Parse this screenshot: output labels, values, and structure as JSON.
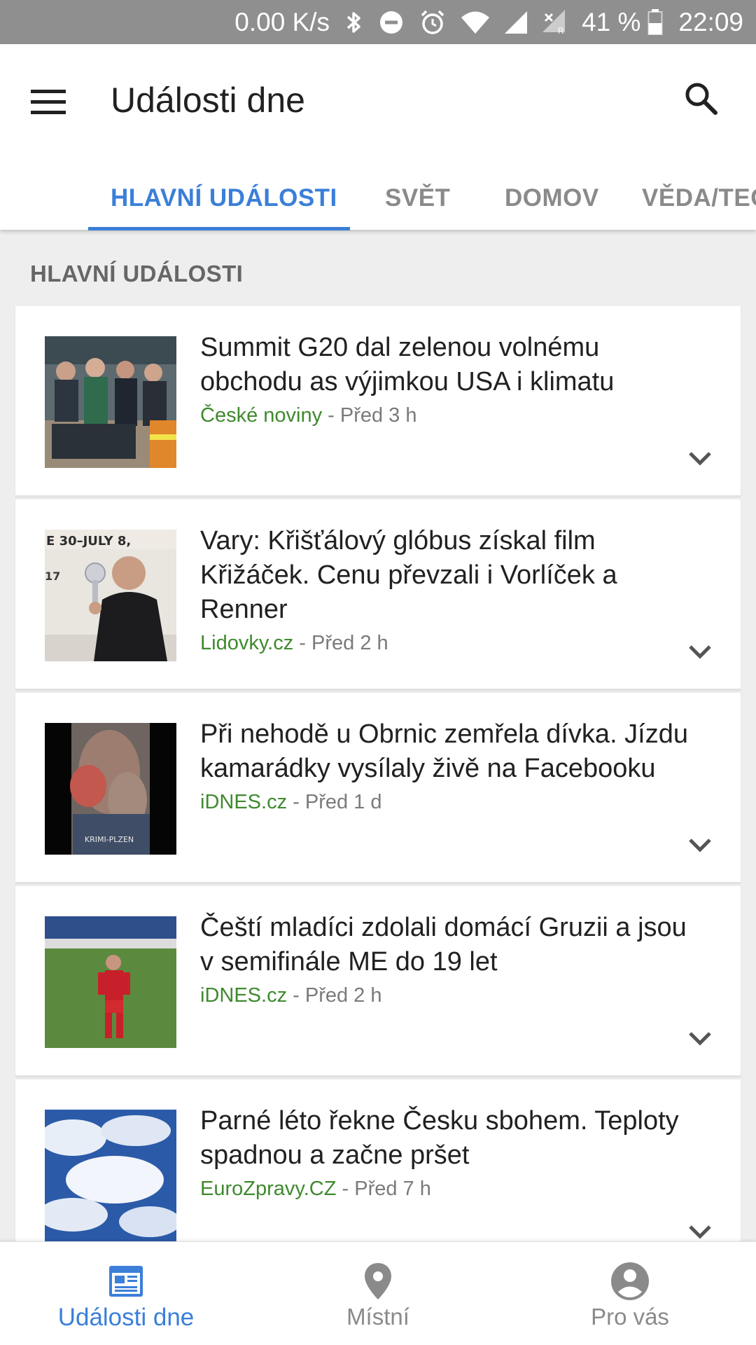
{
  "status_bar": {
    "net_speed": "0.00 K/s",
    "battery": "41 %",
    "time": "22:09",
    "icons": [
      "bluetooth-icon",
      "dnd-icon",
      "alarm-icon",
      "wifi-icon",
      "signal-icon",
      "signal-roaming-icon",
      "battery-icon"
    ]
  },
  "appbar": {
    "title": "Události dne",
    "menu_icon": "menu-icon",
    "search_icon": "search-icon"
  },
  "tabs": [
    {
      "label": "HLAVNÍ UDÁLOSTI",
      "active": true
    },
    {
      "label": "SVĚT",
      "active": false
    },
    {
      "label": "DOMOV",
      "active": false
    },
    {
      "label": "VĚDA/TECHNOLOGIE",
      "active": false
    }
  ],
  "accent_color": "#3b7fd8",
  "source_color": "#3f8a2e",
  "section_title": "HLAVNÍ UDÁLOSTI",
  "articles": [
    {
      "headline": "Summit G20 dal zelenou volnému obchodu as výjimkou USA i klimatu",
      "source": "České noviny",
      "time": " - Před 3 h"
    },
    {
      "headline": "Vary: Křišťálový glóbus získal film Křižáček. Cenu převzali i Vorlíček a Renner",
      "source": "Lidovky.cz",
      "time": " - Před 2 h"
    },
    {
      "headline": "Při nehodě u Obrnic zemřela dívka. Jízdu kamarádky vysílaly živě na Facebooku",
      "source": "iDNES.cz",
      "time": " - Před 1 d"
    },
    {
      "headline": "Čeští mladíci zdolali domácí Gruzii a jsou v semifinále ME do 19 let",
      "source": "iDNES.cz",
      "time": " - Před 2 h"
    },
    {
      "headline": "Parné léto řekne Česku sbohem. Teploty spadnou a začne pršet",
      "source": "EuroZpravy.CZ",
      "time": " - Před 7 h"
    }
  ],
  "bottom_nav": [
    {
      "label": "Události dne",
      "icon": "calendar-news-icon",
      "active": true
    },
    {
      "label": "Místní",
      "icon": "location-pin-icon",
      "active": false
    },
    {
      "label": "Pro vás",
      "icon": "account-icon",
      "active": false
    }
  ]
}
